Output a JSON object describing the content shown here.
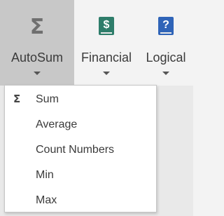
{
  "ribbon": {
    "buttons": [
      {
        "label": "AutoSum",
        "icon": "sigma-icon",
        "glyph": "Σ",
        "active": true
      },
      {
        "label": "Financial",
        "icon": "financial-book-icon",
        "glyph": "$"
      },
      {
        "label": "Logical",
        "icon": "logical-book-icon",
        "glyph": "?"
      }
    ]
  },
  "menu": {
    "items": [
      {
        "label": "Sum",
        "glyph": "Σ"
      },
      {
        "label": "Average"
      },
      {
        "label": "Count Numbers"
      },
      {
        "label": "Min"
      },
      {
        "label": "Max"
      }
    ]
  },
  "colors": {
    "active_bg": "#c8c8c8",
    "financial_icon": "#2e7d6a",
    "logical_icon": "#2f64b8"
  }
}
